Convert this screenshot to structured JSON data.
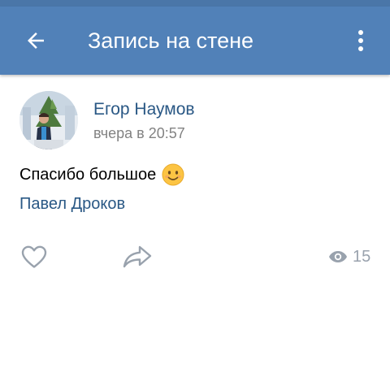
{
  "header": {
    "title": "Запись на стене",
    "back_icon": "arrow-left-icon",
    "more_icon": "more-vertical-icon"
  },
  "post": {
    "author": "Егор Наумов",
    "time": "вчера в 20:57",
    "text": "Спасибо большое",
    "emoji": "slightly-smiling-face-icon",
    "mention": "Павел Дроков",
    "views": "15"
  },
  "colors": {
    "header_bg": "#5181b8",
    "status_bar": "#4a76a8",
    "link": "#2a5885",
    "meta": "#828282",
    "icon": "#99a2ad"
  }
}
